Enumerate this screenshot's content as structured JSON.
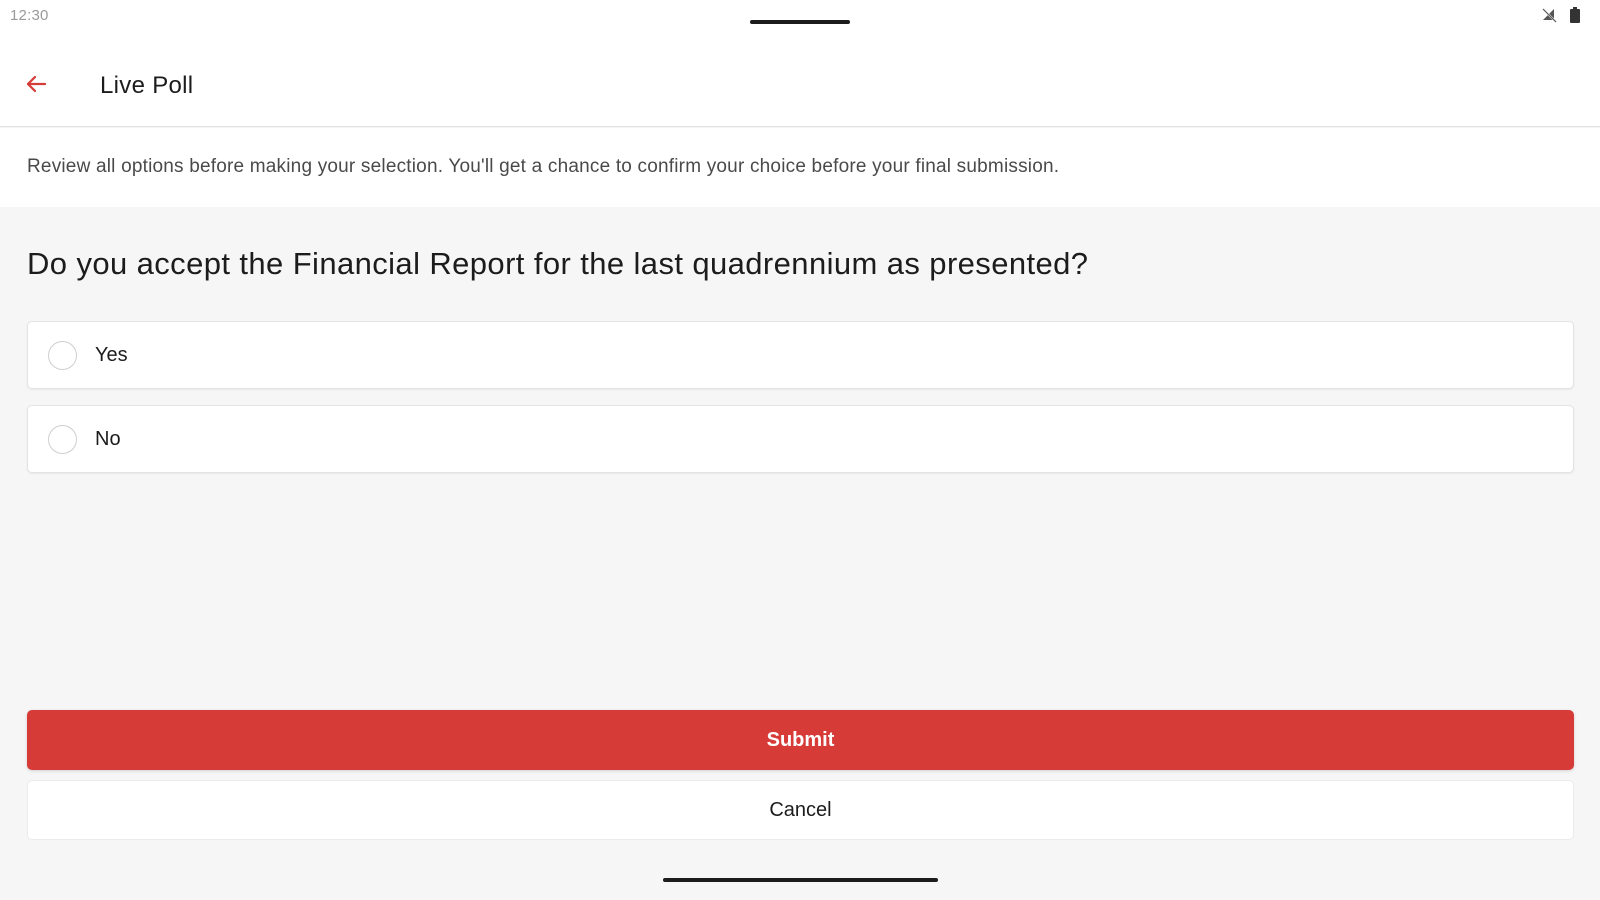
{
  "status_bar": {
    "time": "12:30",
    "icons": [
      "no-signal-icon",
      "battery-icon"
    ]
  },
  "header": {
    "back_icon": "arrow-left-icon",
    "title": "Live Poll"
  },
  "instructions": {
    "text": "Review all options before making your selection. You'll get a chance to confirm your choice before your final submission."
  },
  "poll": {
    "question": "Do you accept the Financial Report for the last quadrennium as presented?",
    "options": [
      {
        "label": "Yes",
        "selected": false
      },
      {
        "label": "No",
        "selected": false
      }
    ]
  },
  "actions": {
    "submit_label": "Submit",
    "cancel_label": "Cancel"
  },
  "colors": {
    "accent": "#d63b38",
    "background": "#f6f6f6",
    "surface": "#ffffff",
    "text": "#1c1c1c"
  }
}
